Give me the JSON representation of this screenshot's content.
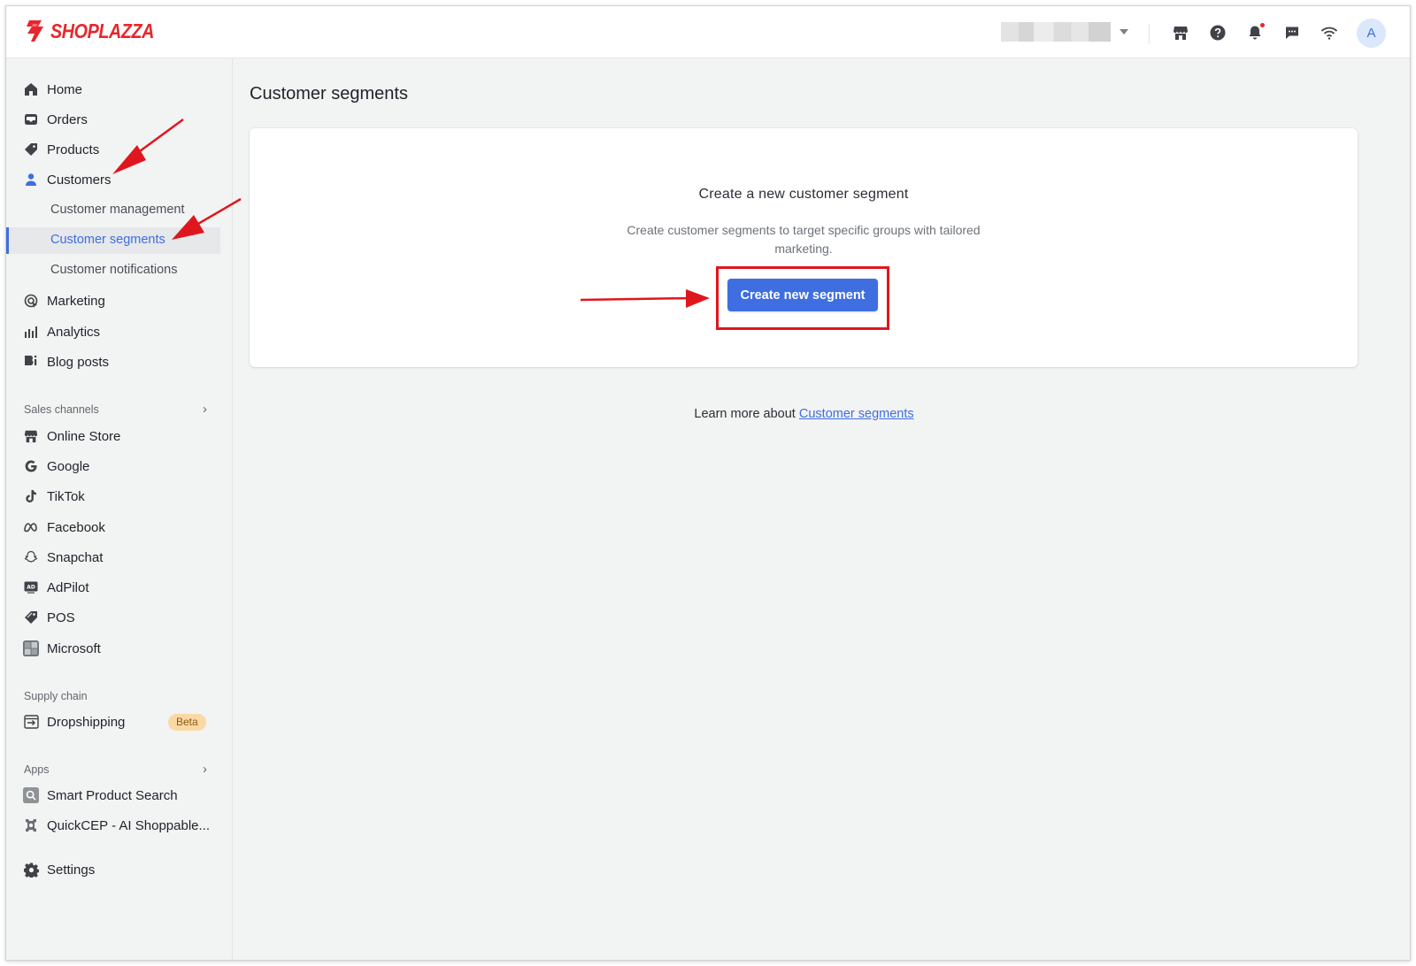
{
  "app": {
    "brand": "SHOPLAZZA",
    "brand_color": "#e8262d",
    "accent_color": "#3e6ee0",
    "avatar_letter": "A"
  },
  "topbar": {
    "icons": [
      "storefront-icon",
      "help-icon",
      "bell-icon",
      "chat-icon",
      "wifi-icon"
    ]
  },
  "sidebar": {
    "main_items": [
      {
        "label": "Home",
        "icon": "home-icon"
      },
      {
        "label": "Orders",
        "icon": "inbox-icon"
      },
      {
        "label": "Products",
        "icon": "tag-icon"
      },
      {
        "label": "Customers",
        "icon": "person-icon"
      }
    ],
    "customer_sub_items": [
      {
        "label": "Customer management",
        "active": false
      },
      {
        "label": "Customer segments",
        "active": true
      },
      {
        "label": "Customer notifications",
        "active": false
      }
    ],
    "more_items": [
      {
        "label": "Marketing",
        "icon": "marketing-icon"
      },
      {
        "label": "Analytics",
        "icon": "bar-chart-icon"
      },
      {
        "label": "Blog posts",
        "icon": "blog-icon"
      }
    ],
    "sales_channels": {
      "heading": "Sales channels",
      "items": [
        {
          "label": "Online Store",
          "icon": "storefront-icon"
        },
        {
          "label": "Google",
          "icon": "google-icon"
        },
        {
          "label": "TikTok",
          "icon": "tiktok-icon"
        },
        {
          "label": "Facebook",
          "icon": "meta-icon"
        },
        {
          "label": "Snapchat",
          "icon": "snapchat-icon"
        },
        {
          "label": "AdPilot",
          "icon": "ad-icon"
        },
        {
          "label": "POS",
          "icon": "pos-tag-icon"
        },
        {
          "label": "Microsoft",
          "icon": "microsoft-icon"
        }
      ]
    },
    "supply_chain": {
      "heading": "Supply chain",
      "items": [
        {
          "label": "Dropshipping",
          "icon": "dropshipping-icon",
          "badge": "Beta"
        }
      ]
    },
    "apps": {
      "heading": "Apps",
      "items": [
        {
          "label": "Smart Product Search",
          "icon": "search-app-icon"
        },
        {
          "label": "QuickCEP - AI Shoppable...",
          "icon": "gear-app-icon"
        }
      ]
    },
    "settings": {
      "label": "Settings",
      "icon": "gear-icon"
    }
  },
  "main": {
    "page_title": "Customer segments",
    "empty_state": {
      "title": "Create a new customer segment",
      "description": "Create customer segments to target specific groups with tailored marketing.",
      "button_label": "Create new segment"
    },
    "learn_more": {
      "prefix": "Learn more about ",
      "link_text": "Customer segments"
    }
  },
  "annotations": {
    "arrow_color": "#e0161e",
    "highlight_color": "#e0161e"
  }
}
